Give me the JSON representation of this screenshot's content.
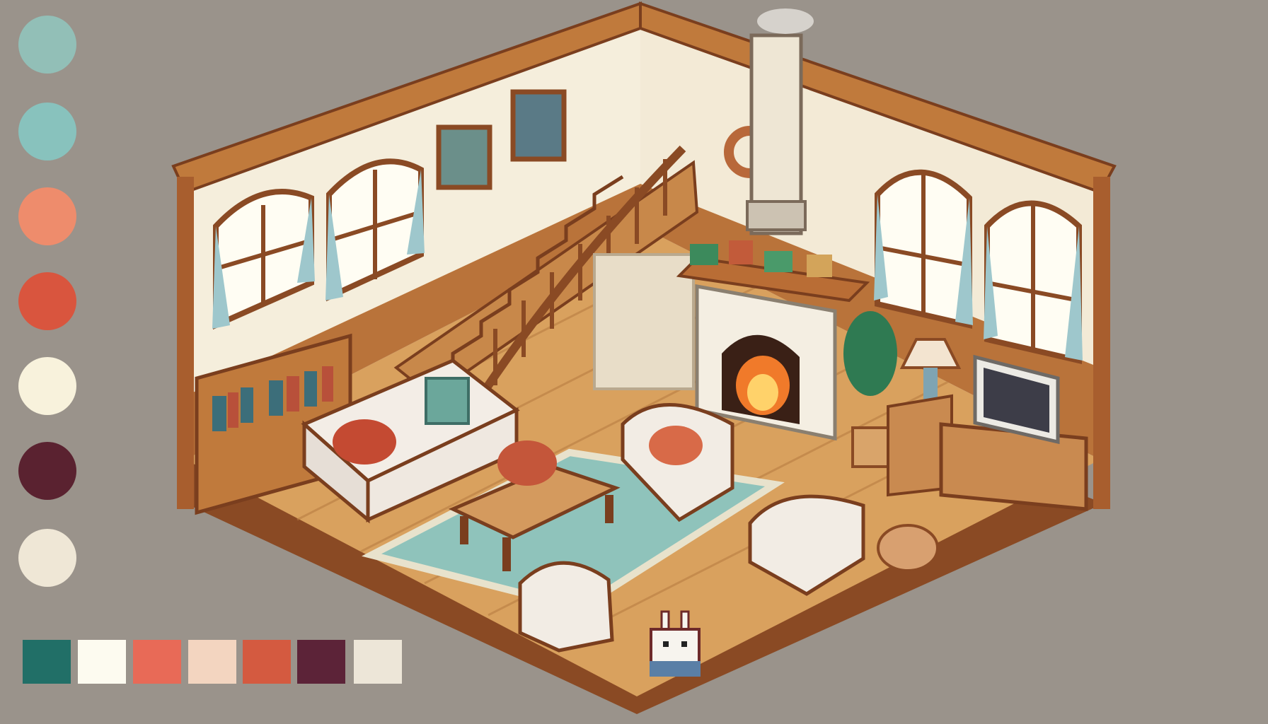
{
  "scene": {
    "palette_circles": [
      {
        "name": "teal-light",
        "color": "#92bfb7"
      },
      {
        "name": "teal",
        "color": "#88c2bd"
      },
      {
        "name": "coral",
        "color": "#ee8c6c"
      },
      {
        "name": "red",
        "color": "#d9553e"
      },
      {
        "name": "cream",
        "color": "#f8f2dc"
      },
      {
        "name": "plum",
        "color": "#5a2230"
      },
      {
        "name": "ivory",
        "color": "#efe7d6"
      }
    ],
    "palette_squares": [
      {
        "name": "dark-teal",
        "color": "#216f67"
      },
      {
        "name": "white",
        "color": "#fdfbf0"
      },
      {
        "name": "salmon",
        "color": "#e86a57"
      },
      {
        "name": "peach",
        "color": "#f3d5c0"
      },
      {
        "name": "brick",
        "color": "#d45a40"
      },
      {
        "name": "wine",
        "color": "#5c2338"
      },
      {
        "name": "bone",
        "color": "#ede6d8"
      }
    ],
    "colors": {
      "background": "#9a938b",
      "wood_dark": "#8a4a24",
      "wood": "#c07a3c",
      "floor": "#d9a15e",
      "wall": "#f5eedc",
      "rug": "#8fc3bb",
      "fire": "#f07a2a"
    },
    "objects": [
      "roof-beam-icon",
      "window-icon",
      "staircase-icon",
      "fireplace-icon",
      "chimney-icon",
      "bookshelf-icon",
      "sofa-icon",
      "armchair-icon",
      "coffee-table-icon",
      "rug-icon",
      "tv-icon",
      "lamp-icon",
      "plant-icon",
      "bunny-icon",
      "cushion-icon",
      "wreath-icon"
    ]
  }
}
